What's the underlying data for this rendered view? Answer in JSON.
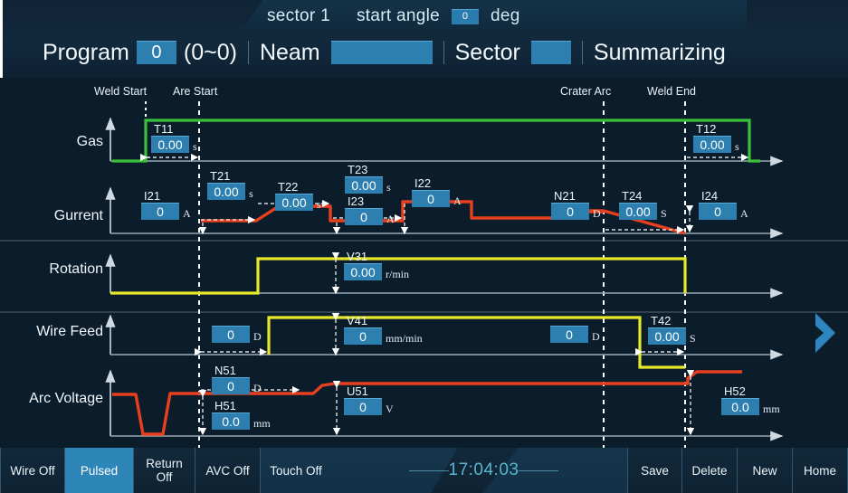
{
  "header": {
    "sector_label": "sector 1",
    "start_angle_label": "start angle",
    "start_angle_value": "0",
    "deg_unit": "deg",
    "program_label": "Program",
    "program_value": "0",
    "program_range": "(0~0)",
    "name_label": "Neam",
    "name_value": "",
    "sector_field_label": "Sector",
    "sector_field_value": "",
    "mode_label": "Summarizing"
  },
  "markers": [
    {
      "name": "weld-start",
      "label": "Weld Start"
    },
    {
      "name": "arc-start",
      "label": "Are Start"
    },
    {
      "name": "crater-arc",
      "label": "Crater Arc"
    },
    {
      "name": "weld-end",
      "label": "Weld End"
    }
  ],
  "rows": [
    {
      "name": "gas",
      "label": "Gas"
    },
    {
      "name": "current",
      "label": "Gurrent"
    },
    {
      "name": "rotation",
      "label": "Rotation"
    },
    {
      "name": "wire-feed",
      "label": "Wire Feed"
    },
    {
      "name": "arc-voltage",
      "label": "Arc Voltage"
    }
  ],
  "fields": {
    "t11": {
      "cap": "T11",
      "value": "0.00",
      "unit": "s"
    },
    "t12": {
      "cap": "T12",
      "value": "0.00",
      "unit": "s"
    },
    "i21": {
      "cap": "I21",
      "value": "0",
      "unit": "A"
    },
    "t21": {
      "cap": "T21",
      "value": "0.00",
      "unit": "s"
    },
    "t22": {
      "cap": "T22",
      "value": "0.00",
      "unit": "s"
    },
    "t23": {
      "cap": "T23",
      "value": "0.00",
      "unit": "s"
    },
    "i23": {
      "cap": "I23",
      "value": "0",
      "unit": "A"
    },
    "i22": {
      "cap": "I22",
      "value": "0",
      "unit": "A"
    },
    "n21": {
      "cap": "N21",
      "value": "0",
      "unit": "D"
    },
    "t24": {
      "cap": "T24",
      "value": "0.00",
      "unit": "S"
    },
    "i24": {
      "cap": "I24",
      "value": "0",
      "unit": "A"
    },
    "v31": {
      "cap": "V31",
      "value": "0.00",
      "unit": "r/min"
    },
    "wf_pre": {
      "cap": "",
      "value": "0",
      "unit": "D"
    },
    "v41": {
      "cap": "V41",
      "value": "0",
      "unit": "mm/min"
    },
    "wf_post": {
      "cap": "",
      "value": "0",
      "unit": "D"
    },
    "t42": {
      "cap": "T42",
      "value": "0.00",
      "unit": "S"
    },
    "n51": {
      "cap": "N51",
      "value": "0",
      "unit": "D"
    },
    "h51": {
      "cap": "H51",
      "value": "0.0",
      "unit": "mm"
    },
    "u51": {
      "cap": "U51",
      "value": "0",
      "unit": "V"
    },
    "h52": {
      "cap": "H52",
      "value": "0.0",
      "unit": "mm"
    }
  },
  "toolbar": {
    "wire": "Wire Off",
    "pulsed": "Pulsed",
    "return": "Return\nOff",
    "return_l1": "Return",
    "return_l2": "Off",
    "avc": "AVC Off",
    "touch": "Touch Off",
    "clock": "17:04:03",
    "save": "Save",
    "delete": "Delete",
    "new": "New",
    "home": "Home"
  },
  "nav": {
    "next_icon": "chevron-right-icon"
  },
  "colors": {
    "background": "#0b1c2b",
    "field_blue": "#2d7fb0",
    "gas_green": "#39c13a",
    "current_red": "#e8401f",
    "rotation_yellow": "#e8e82a",
    "axis_grey": "#9aa8b4",
    "accent_cyan": "#58b6cf"
  }
}
